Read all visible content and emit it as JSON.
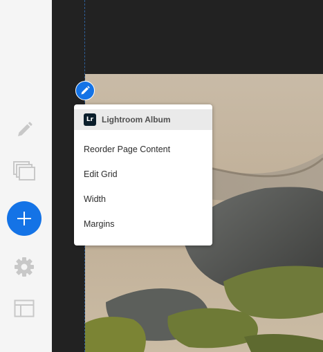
{
  "sidebar": {
    "tools": [
      {
        "icon": "pencil-icon"
      },
      {
        "icon": "duplicate-pages-icon"
      },
      {
        "icon": "plus-icon"
      },
      {
        "icon": "gear-icon"
      },
      {
        "icon": "layout-icon"
      }
    ]
  },
  "context_menu": {
    "header": {
      "badge": "Lr",
      "label": "Lightroom Album"
    },
    "items": [
      "Reorder Page Content",
      "Edit Grid",
      "Width",
      "Margins"
    ]
  },
  "colors": {
    "accent": "#1473e6",
    "sidebar_bg": "#f5f5f5",
    "canvas_bg": "#222222",
    "icon_gray": "#c8c8c8"
  }
}
